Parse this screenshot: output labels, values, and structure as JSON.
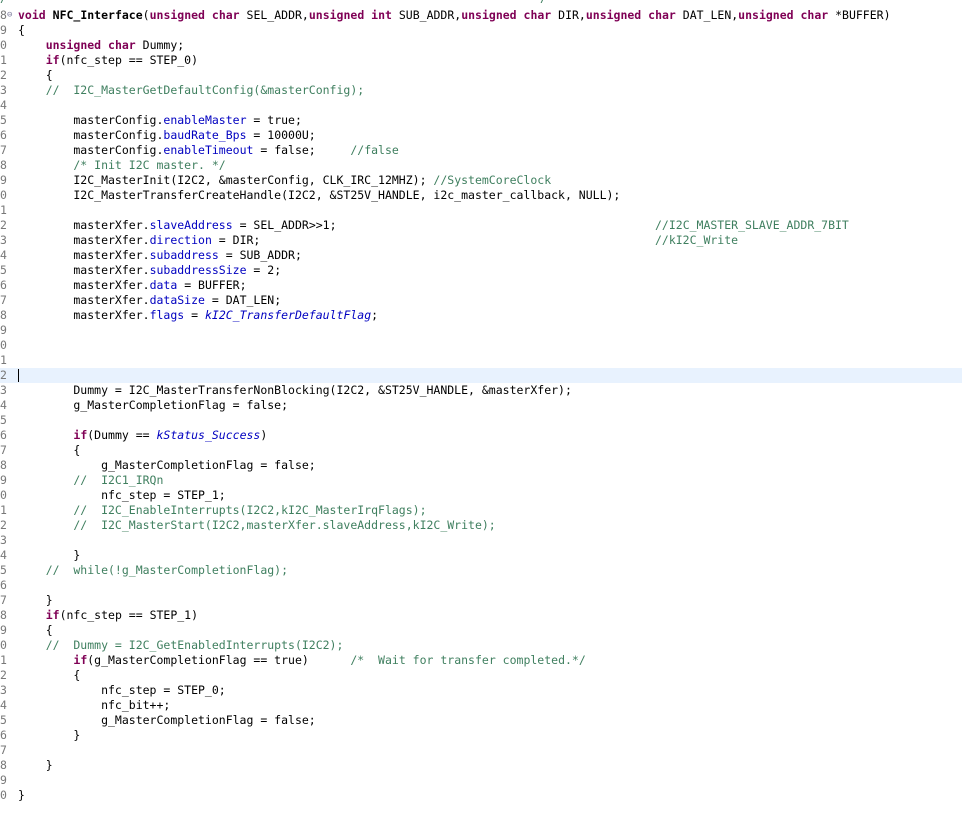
{
  "editor": {
    "top_fragment": "/*****************************************************************************/",
    "lines": [
      {
        "num": "8",
        "fold": true,
        "tokens": [
          [
            "kw",
            "void"
          ],
          [
            "plain",
            " "
          ],
          [
            "fn",
            "NFC_Interface"
          ],
          [
            "plain",
            "("
          ],
          [
            "kw",
            "unsigned char"
          ],
          [
            "plain",
            " SEL_ADDR,"
          ],
          [
            "kw",
            "unsigned int"
          ],
          [
            "plain",
            " SUB_ADDR,"
          ],
          [
            "kw",
            "unsigned char"
          ],
          [
            "plain",
            " DIR,"
          ],
          [
            "kw",
            "unsigned char"
          ],
          [
            "plain",
            " DAT_LEN,"
          ],
          [
            "kw",
            "unsigned char"
          ],
          [
            "plain",
            " *BUFFER)"
          ]
        ]
      },
      {
        "num": "9",
        "tokens": [
          [
            "plain",
            "{"
          ]
        ]
      },
      {
        "num": "0",
        "tokens": [
          [
            "plain",
            "    "
          ],
          [
            "kw",
            "unsigned char"
          ],
          [
            "plain",
            " Dummy;"
          ]
        ]
      },
      {
        "num": "1",
        "tokens": [
          [
            "plain",
            "    "
          ],
          [
            "kw",
            "if"
          ],
          [
            "plain",
            "(nfc_step == STEP_0)"
          ]
        ]
      },
      {
        "num": "2",
        "tokens": [
          [
            "plain",
            "    {"
          ]
        ]
      },
      {
        "num": "3",
        "tokens": [
          [
            "com",
            "    //  I2C_MasterGetDefaultConfig(&masterConfig);"
          ]
        ]
      },
      {
        "num": "4",
        "tokens": []
      },
      {
        "num": "5",
        "tokens": [
          [
            "plain",
            "        masterConfig."
          ],
          [
            "field",
            "enableMaster"
          ],
          [
            "plain",
            " = true;"
          ]
        ]
      },
      {
        "num": "6",
        "tokens": [
          [
            "plain",
            "        masterConfig."
          ],
          [
            "field",
            "baudRate_Bps"
          ],
          [
            "plain",
            " = 10000U;"
          ]
        ]
      },
      {
        "num": "7",
        "tokens": [
          [
            "plain",
            "        masterConfig."
          ],
          [
            "field",
            "enableTimeout"
          ],
          [
            "plain",
            " = false;     "
          ],
          [
            "com",
            "//false"
          ]
        ]
      },
      {
        "num": "8",
        "tokens": [
          [
            "com",
            "        /* Init I2C master. */"
          ]
        ]
      },
      {
        "num": "9",
        "tokens": [
          [
            "plain",
            "        I2C_MasterInit(I2C2, &masterConfig, CLK_IRC_12MHZ); "
          ],
          [
            "com",
            "//SystemCoreClock"
          ]
        ]
      },
      {
        "num": "0",
        "tokens": [
          [
            "plain",
            "        I2C_MasterTransferCreateHandle(I2C2, &ST25V_HANDLE, i2c_master_callback, NULL);"
          ]
        ]
      },
      {
        "num": "1",
        "tokens": []
      },
      {
        "num": "2",
        "tokens": [
          [
            "plain",
            "        masterXfer."
          ],
          [
            "field",
            "slaveAddress"
          ],
          [
            "plain",
            " = SEL_ADDR>>1;                                              "
          ],
          [
            "com",
            "//I2C_MASTER_SLAVE_ADDR_7BIT"
          ]
        ]
      },
      {
        "num": "3",
        "tokens": [
          [
            "plain",
            "        masterXfer."
          ],
          [
            "field",
            "direction"
          ],
          [
            "plain",
            " = DIR;                                                         "
          ],
          [
            "com",
            "//kI2C_Write"
          ]
        ]
      },
      {
        "num": "4",
        "tokens": [
          [
            "plain",
            "        masterXfer."
          ],
          [
            "field",
            "subaddress"
          ],
          [
            "plain",
            " = SUB_ADDR;"
          ]
        ]
      },
      {
        "num": "5",
        "tokens": [
          [
            "plain",
            "        masterXfer."
          ],
          [
            "field",
            "subaddressSize"
          ],
          [
            "plain",
            " = 2;"
          ]
        ]
      },
      {
        "num": "6",
        "tokens": [
          [
            "plain",
            "        masterXfer."
          ],
          [
            "field",
            "data"
          ],
          [
            "plain",
            " = BUFFER;"
          ]
        ]
      },
      {
        "num": "7",
        "tokens": [
          [
            "plain",
            "        masterXfer."
          ],
          [
            "field",
            "dataSize"
          ],
          [
            "plain",
            " = DAT_LEN;"
          ]
        ]
      },
      {
        "num": "8",
        "tokens": [
          [
            "plain",
            "        masterXfer."
          ],
          [
            "field",
            "flags"
          ],
          [
            "plain",
            " = "
          ],
          [
            "enum",
            "kI2C_TransferDefaultFlag"
          ],
          [
            "plain",
            ";"
          ]
        ]
      },
      {
        "num": "9",
        "tokens": []
      },
      {
        "num": "0",
        "tokens": []
      },
      {
        "num": "1",
        "tokens": []
      },
      {
        "num": "2",
        "current": true,
        "tokens": []
      },
      {
        "num": "3",
        "tokens": [
          [
            "plain",
            "        Dummy = I2C_MasterTransferNonBlocking(I2C2, &ST25V_HANDLE, &masterXfer);"
          ]
        ]
      },
      {
        "num": "4",
        "tokens": [
          [
            "plain",
            "        g_MasterCompletionFlag = false;"
          ]
        ]
      },
      {
        "num": "5",
        "tokens": []
      },
      {
        "num": "6",
        "tokens": [
          [
            "plain",
            "        "
          ],
          [
            "kw",
            "if"
          ],
          [
            "plain",
            "(Dummy == "
          ],
          [
            "enum",
            "kStatus_Success"
          ],
          [
            "plain",
            ")"
          ]
        ]
      },
      {
        "num": "7",
        "tokens": [
          [
            "plain",
            "        {"
          ]
        ]
      },
      {
        "num": "8",
        "tokens": [
          [
            "plain",
            "            g_MasterCompletionFlag = false;"
          ]
        ]
      },
      {
        "num": "9",
        "tokens": [
          [
            "com",
            "        //  I2C1_IRQn"
          ]
        ]
      },
      {
        "num": "0",
        "tokens": [
          [
            "plain",
            "            nfc_step = STEP_1;"
          ]
        ]
      },
      {
        "num": "1",
        "tokens": [
          [
            "com",
            "        //  I2C_EnableInterrupts(I2C2,kI2C_MasterIrqFlags);"
          ]
        ]
      },
      {
        "num": "2",
        "tokens": [
          [
            "com",
            "        //  I2C_MasterStart(I2C2,masterXfer.slaveAddress,kI2C_Write);"
          ]
        ]
      },
      {
        "num": "3",
        "tokens": []
      },
      {
        "num": "4",
        "tokens": [
          [
            "plain",
            "        }"
          ]
        ]
      },
      {
        "num": "5",
        "tokens": [
          [
            "com",
            "    //  while(!g_MasterCompletionFlag);"
          ]
        ]
      },
      {
        "num": "6",
        "tokens": []
      },
      {
        "num": "7",
        "tokens": [
          [
            "plain",
            "    }"
          ]
        ]
      },
      {
        "num": "8",
        "tokens": [
          [
            "plain",
            "    "
          ],
          [
            "kw",
            "if"
          ],
          [
            "plain",
            "(nfc_step == STEP_1)"
          ]
        ]
      },
      {
        "num": "9",
        "tokens": [
          [
            "plain",
            "    {"
          ]
        ]
      },
      {
        "num": "0",
        "tokens": [
          [
            "com",
            "    //  Dummy = I2C_GetEnabledInterrupts(I2C2);"
          ]
        ]
      },
      {
        "num": "1",
        "tokens": [
          [
            "plain",
            "        "
          ],
          [
            "kw",
            "if"
          ],
          [
            "plain",
            "(g_MasterCompletionFlag == true)      "
          ],
          [
            "com",
            "/*  Wait for transfer completed.*/"
          ]
        ]
      },
      {
        "num": "2",
        "tokens": [
          [
            "plain",
            "        {"
          ]
        ]
      },
      {
        "num": "3",
        "tokens": [
          [
            "plain",
            "            nfc_step = STEP_0;"
          ]
        ]
      },
      {
        "num": "4",
        "tokens": [
          [
            "plain",
            "            nfc_bit++;"
          ]
        ]
      },
      {
        "num": "5",
        "tokens": [
          [
            "plain",
            "            g_MasterCompletionFlag = false;"
          ]
        ]
      },
      {
        "num": "6",
        "tokens": [
          [
            "plain",
            "        }"
          ]
        ]
      },
      {
        "num": "7",
        "tokens": []
      },
      {
        "num": "8",
        "tokens": [
          [
            "plain",
            "    }"
          ]
        ]
      },
      {
        "num": "9",
        "tokens": []
      },
      {
        "num": "0",
        "tokens": [
          [
            "plain",
            "}"
          ]
        ]
      }
    ]
  }
}
